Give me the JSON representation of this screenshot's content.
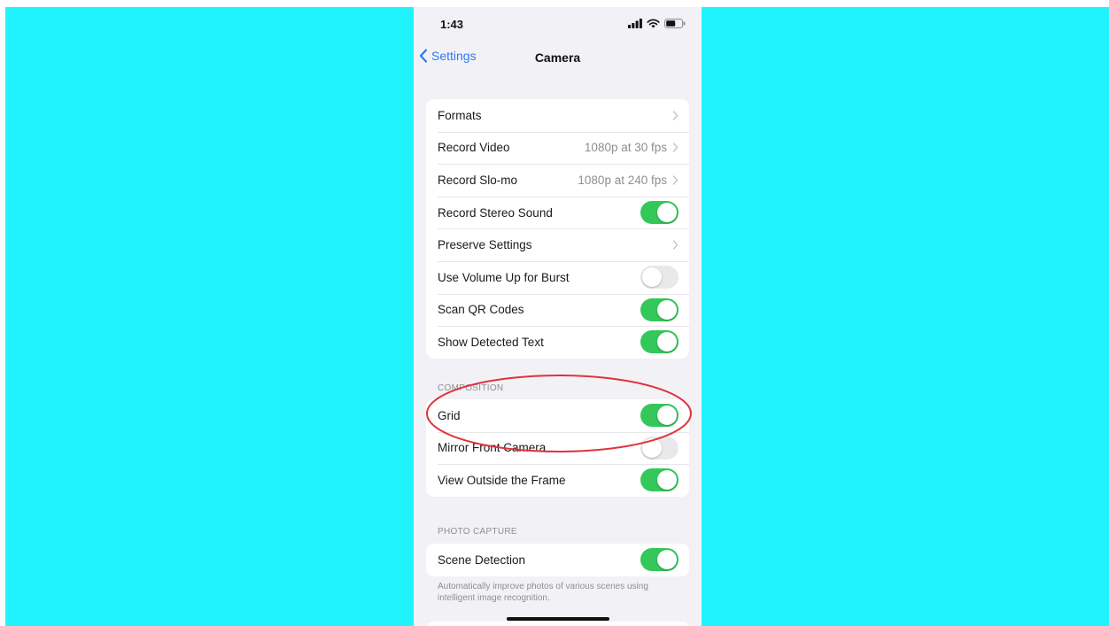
{
  "status_bar": {
    "time": "1:43"
  },
  "nav": {
    "back_label": "Settings",
    "title": "Camera"
  },
  "group_main": {
    "rows": [
      {
        "label": "Formats",
        "value": "",
        "control": "chevron"
      },
      {
        "label": "Record Video",
        "value": "1080p at 30 fps",
        "control": "chevron"
      },
      {
        "label": "Record Slo-mo",
        "value": "1080p at 240 fps",
        "control": "chevron"
      },
      {
        "label": "Record Stereo Sound",
        "control": "toggle",
        "on": true
      },
      {
        "label": "Preserve Settings",
        "value": "",
        "control": "chevron"
      },
      {
        "label": "Use Volume Up for Burst",
        "control": "toggle",
        "on": false
      },
      {
        "label": "Scan QR Codes",
        "control": "toggle",
        "on": true
      },
      {
        "label": "Show Detected Text",
        "control": "toggle",
        "on": true
      }
    ]
  },
  "composition": {
    "header": "COMPOSITION",
    "rows": [
      {
        "label": "Grid",
        "control": "toggle",
        "on": true
      },
      {
        "label": "Mirror Front Camera",
        "control": "toggle",
        "on": false
      },
      {
        "label": "View Outside the Frame",
        "control": "toggle",
        "on": true
      }
    ]
  },
  "photo_capture": {
    "header": "PHOTO CAPTURE",
    "rows": [
      {
        "label": "Scene Detection",
        "control": "toggle",
        "on": true
      }
    ],
    "footer": "Automatically improve photos of various scenes using intelligent image recognition."
  },
  "colors": {
    "backdrop": "#20f3fd",
    "accent": "#2c7bf6",
    "toggle_on": "#34c759",
    "toggle_off": "#e9e9eb",
    "highlight": "#e0323c"
  },
  "icons": [
    "cellular-signal-icon",
    "wifi-icon",
    "battery-icon",
    "chevron-left-icon",
    "chevron-right-icon"
  ]
}
